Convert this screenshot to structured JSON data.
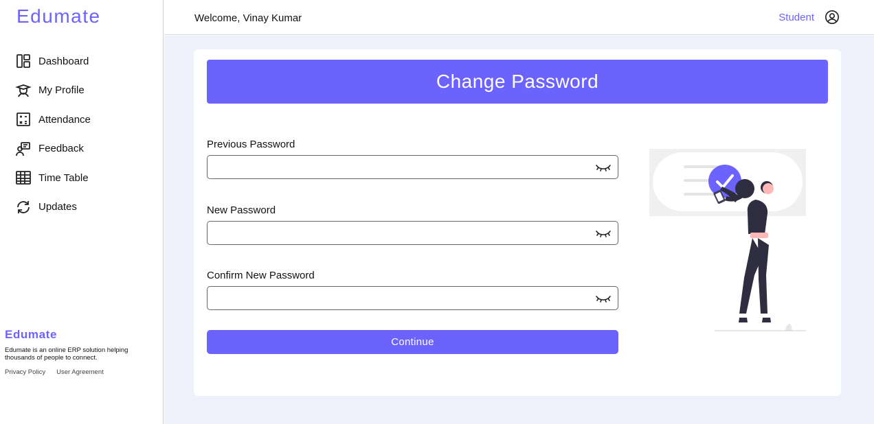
{
  "sidebar": {
    "brand": "Edumate",
    "items": [
      {
        "label": "Dashboard",
        "icon": "dashboard-icon"
      },
      {
        "label": "My Profile",
        "icon": "profile-icon"
      },
      {
        "label": "Attendance",
        "icon": "attendance-icon"
      },
      {
        "label": "Feedback",
        "icon": "feedback-icon"
      },
      {
        "label": "Time Table",
        "icon": "timetable-icon"
      },
      {
        "label": "Updates",
        "icon": "updates-icon"
      }
    ],
    "footer": {
      "brand": "Edumate",
      "description": "Edumate is an online ERP solution helping thousands of people to connect.",
      "links": [
        "Privacy Policy",
        "User Agreement"
      ]
    }
  },
  "topbar": {
    "welcome": "Welcome, Vinay Kumar",
    "role": "Student",
    "user_icon": "user-circle-icon"
  },
  "form": {
    "title": "Change Password",
    "fields": [
      {
        "label": "Previous Password",
        "value": "",
        "icon": "eye-closed-icon"
      },
      {
        "label": "New Password",
        "value": "",
        "icon": "eye-closed-icon"
      },
      {
        "label": "Confirm New Password",
        "value": "",
        "icon": "eye-closed-icon"
      }
    ],
    "submit_label": "Continue"
  },
  "colors": {
    "accent": "#6c63ff",
    "background": "#eef0fc",
    "illustration_dark": "#2f2e41",
    "illustration_skin": "#ffb8b8"
  }
}
